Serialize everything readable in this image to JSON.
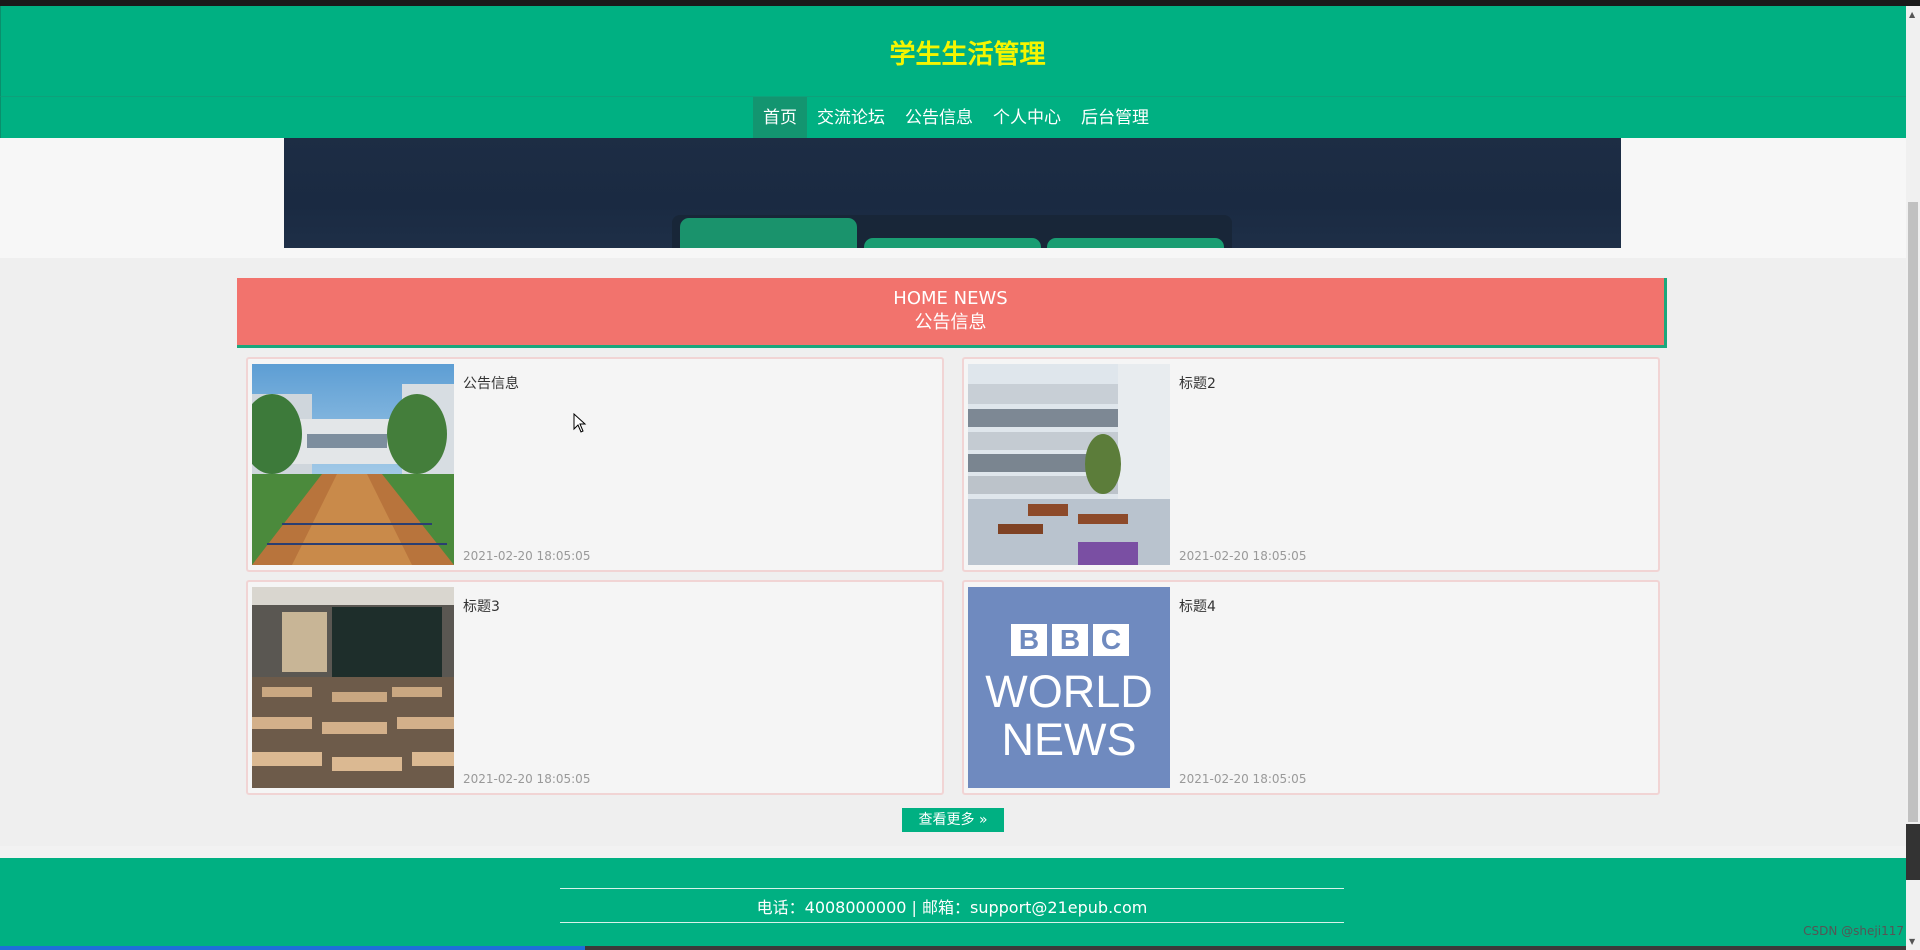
{
  "header": {
    "title": "学生生活管理"
  },
  "nav": {
    "items": [
      {
        "label": "首页",
        "active": true
      },
      {
        "label": "交流论坛"
      },
      {
        "label": "公告信息"
      },
      {
        "label": "个人中心"
      },
      {
        "label": "后台管理"
      }
    ]
  },
  "news": {
    "heading_en": "HOME NEWS",
    "heading_cn": "公告信息",
    "items": [
      {
        "title": "公告信息",
        "date": "2021-02-20 18:05:05",
        "image": "school-courtyard-illustration"
      },
      {
        "title": "标题2",
        "date": "2021-02-20 18:05:05",
        "image": "campus-building-courtyard"
      },
      {
        "title": "标题3",
        "date": "2021-02-20 18:05:05",
        "image": "classroom-desks"
      },
      {
        "title": "标题4",
        "date": "2021-02-20 18:05:05",
        "image": "bbc-world-news-logo"
      }
    ],
    "more_label": "查看更多",
    "logo_text": [
      "BBC",
      "WORLD",
      "NEWS"
    ]
  },
  "footer": {
    "contact": "电话：4008000000 | 邮箱：support@21epub.com"
  },
  "watermark": "CSDN @sheji117",
  "colors": {
    "primary": "#00b082",
    "news_header": "#f2736d",
    "title_yellow": "#f5f500"
  }
}
